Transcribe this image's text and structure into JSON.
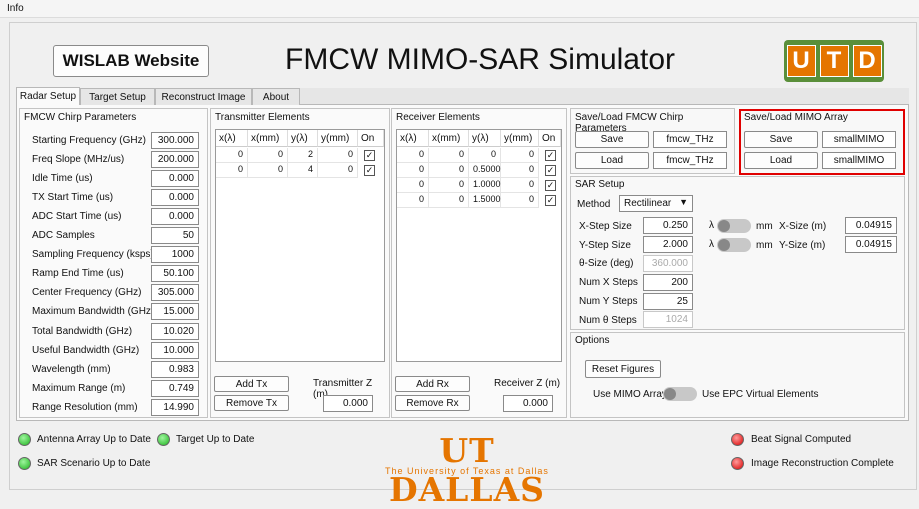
{
  "menu": {
    "info": "Info"
  },
  "header": {
    "website_button": "WISLAB Website",
    "title": "FMCW MIMO-SAR Simulator",
    "logo_letters": [
      "U",
      "T",
      "D"
    ]
  },
  "tabs": [
    "Radar Setup",
    "Target Setup",
    "Reconstruct Image",
    "About"
  ],
  "chirp": {
    "title": "FMCW Chirp Parameters",
    "rows": [
      {
        "label": "Starting Frequency (GHz)",
        "value": "300.000"
      },
      {
        "label": "Freq Slope (MHz/us)",
        "value": "200.000"
      },
      {
        "label": "Idle Time (us)",
        "value": "0.000"
      },
      {
        "label": "TX Start Time (us)",
        "value": "0.000"
      },
      {
        "label": "ADC Start Time (us)",
        "value": "0.000"
      },
      {
        "label": "ADC Samples",
        "value": "50"
      },
      {
        "label": "Sampling Frequency (ksps)",
        "value": "1000"
      },
      {
        "label": "Ramp End Time (us)",
        "value": "50.100"
      },
      {
        "label": "Center Frequency (GHz)",
        "value": "305.000"
      },
      {
        "label": "Maximum Bandwidth (GHz)",
        "value": "15.000"
      },
      {
        "label": "Total Bandwidth (GHz)",
        "value": "10.020"
      },
      {
        "label": "Useful Bandwidth (GHz)",
        "value": "10.000"
      },
      {
        "label": "Wavelength (mm)",
        "value": "0.983"
      },
      {
        "label": "Maximum Range (m)",
        "value": "0.749"
      },
      {
        "label": "Range Resolution (mm)",
        "value": "14.990"
      }
    ]
  },
  "tx": {
    "title": "Transmitter Elements",
    "headers": [
      "x(λ)",
      "x(mm)",
      "y(λ)",
      "y(mm)",
      "On"
    ],
    "rows": [
      [
        "0",
        "0",
        "2",
        "0"
      ],
      [
        "0",
        "0",
        "4",
        "0"
      ]
    ],
    "add": "Add Tx",
    "remove": "Remove Tx",
    "z_label": "Transmitter Z (m)",
    "z_value": "0.000"
  },
  "rx": {
    "title": "Receiver Elements",
    "headers": [
      "x(λ)",
      "x(mm)",
      "y(λ)",
      "y(mm)",
      "On"
    ],
    "rows": [
      [
        "0",
        "0",
        "0",
        "0"
      ],
      [
        "0",
        "0",
        "0.5000",
        "0"
      ],
      [
        "0",
        "0",
        "1.0000",
        "0"
      ],
      [
        "0",
        "0",
        "1.5000",
        "0"
      ]
    ],
    "add": "Add Rx",
    "remove": "Remove Rx",
    "z_label": "Receiver Z (m)",
    "z_value": "0.000"
  },
  "save_chirp": {
    "title": "Save/Load FMCW Chirp Parameters",
    "save": "Save",
    "load": "Load",
    "save_name": "fmcw_THz",
    "load_name": "fmcw_THz"
  },
  "save_mimo": {
    "title": "Save/Load MIMO Array",
    "save": "Save",
    "load": "Load",
    "save_name": "smallMIMO",
    "load_name": "smallMIMO"
  },
  "sar": {
    "title": "SAR Setup",
    "method_label": "Method",
    "method_value": "Rectilinear",
    "x_step_label": "X-Step Size",
    "x_step": "0.250",
    "y_step_label": "Y-Step Size",
    "y_step": "2.000",
    "theta_label": "θ-Size (deg)",
    "theta": "360.000",
    "nx_label": "Num X Steps",
    "nx": "200",
    "ny_label": "Num Y Steps",
    "ny": "25",
    "nt_label": "Num θ Steps",
    "nt": "1024",
    "lambda": "λ",
    "mm": "mm",
    "x_size_label": "X-Size (m)",
    "x_size": "0.04915",
    "y_size_label": "Y-Size (m)",
    "y_size": "0.04915"
  },
  "options": {
    "title": "Options",
    "reset": "Reset Figures",
    "mimo_label": "Use MIMO Array",
    "epc_label": "Use EPC Virtual Elements"
  },
  "status": {
    "antenna": "Antenna Array Up to Date",
    "target": "Target Up to Date",
    "scenario": "SAR Scenario Up to Date",
    "beat": "Beat Signal Computed",
    "image": "Image Reconstruction Complete"
  },
  "footer": {
    "dallas": "UT DALLAS",
    "dallas_sub": "The University of Texas at Dallas"
  },
  "colors": {
    "accent": "#e57500",
    "logo_green": "#5a8f3a",
    "status_ok": "#1fb31f",
    "status_bad": "#d80000",
    "highlight": "#e00000"
  }
}
